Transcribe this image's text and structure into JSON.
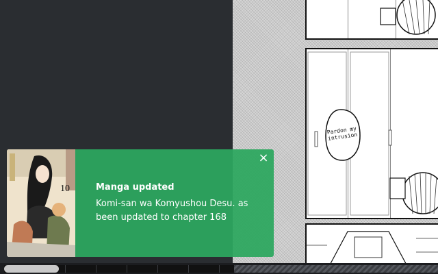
{
  "notification": {
    "title": "Manga updated",
    "message": "Komi-san wa Komyushou Desu. as been updated to chapter 168",
    "close_icon": "×",
    "cover_volume_label": "10",
    "accent_color": "#2da75f"
  },
  "reader": {
    "speech_bubble_text": "Pardon my\nintrusion"
  },
  "icons": {
    "close": "close-icon"
  }
}
